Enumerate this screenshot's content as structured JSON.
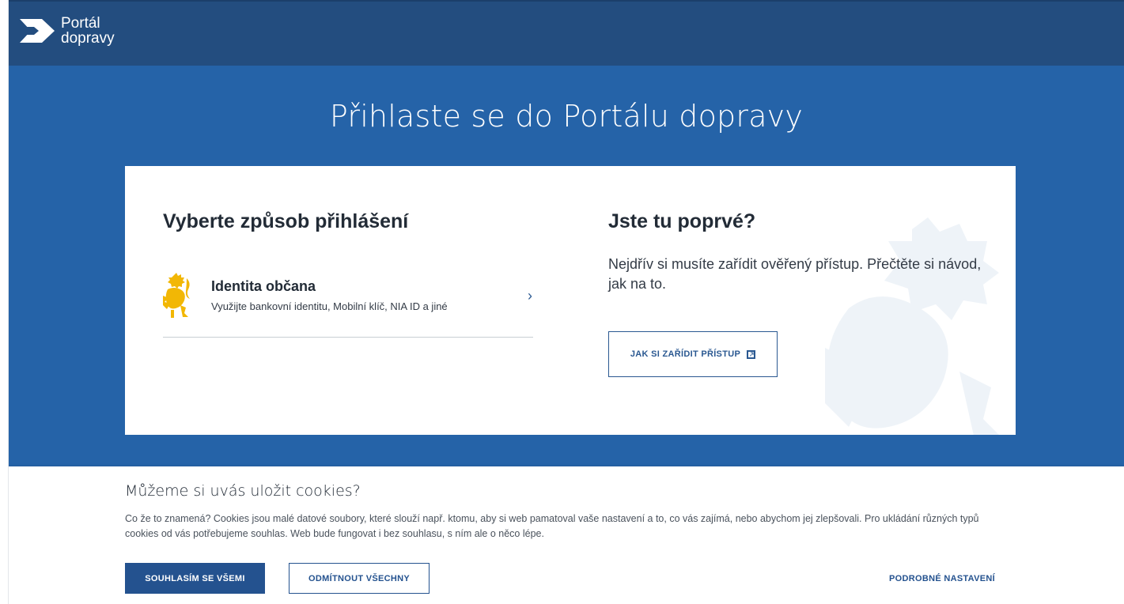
{
  "header": {
    "logo_line1": "Portál",
    "logo_line2": "dopravy",
    "logo_icon": "arrow-logo-icon"
  },
  "hero": {
    "title": "Přihlaste se do Portálu dopravy"
  },
  "login": {
    "title": "Vyberte způsob přihlášení",
    "options": [
      {
        "icon": "czech-lion-icon",
        "title": "Identita občana",
        "subtitle": "Využijte bankovní identitu, Mobilní klíč, NIA ID a jiné"
      }
    ]
  },
  "first_time": {
    "title": "Jste tu poprvé?",
    "text": "Nejdřív si musíte zařídit ověřený přístup. Přečtěte si návod, jak na to.",
    "button_label": "JAK SI ZAŘÍDIT PŘÍSTUP"
  },
  "cookies": {
    "title": "Můžeme si uvás uložit cookies?",
    "text": "Co že to znamená? Cookies jsou malé datové soubory, které slouží např. ktomu, aby si web pamatoval vaše nastavení a to, co vás zajímá, nebo abychom jej zlepšovali. Pro ukládání různých typů cookies od vás potřebujeme souhlas. Web bude fungovat i bez souhlasu, s ním ale o něco lépe.",
    "accept_all": "SOUHLASÍM SE VŠEMI",
    "reject_all": "ODMÍTNOUT VŠECHNY",
    "settings": "PODROBNÉ NASTAVENÍ"
  },
  "colors": {
    "header_bg": "#234d7f",
    "hero_bg": "#2563a8",
    "accent": "#24528f",
    "lion_gold": "#f2b705"
  }
}
